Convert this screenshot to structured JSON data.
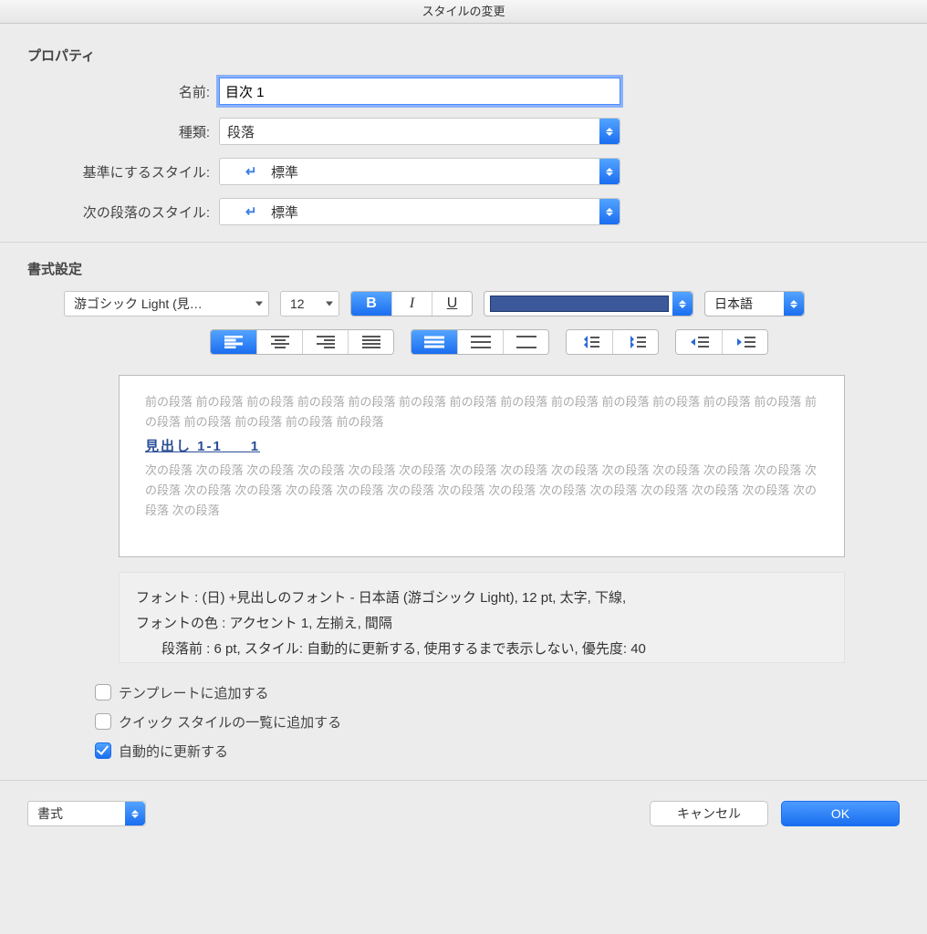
{
  "title": "スタイルの変更",
  "properties": {
    "section": "プロパティ",
    "name_label": "名前:",
    "name_value": "目次 1",
    "type_label": "種類:",
    "type_value": "段落",
    "based_on_label": "基準にするスタイル:",
    "based_on_value": "標準",
    "next_para_label": "次の段落のスタイル:",
    "next_para_value": "標準"
  },
  "formatting": {
    "section": "書式設定",
    "font_name": "游ゴシック Light (見…",
    "font_size": "12",
    "bold": "B",
    "italic": "I",
    "underline": "U",
    "color_hex": "#3b599a",
    "language": "日本語"
  },
  "preview": {
    "prev_para_word": "前の段落",
    "heading": "見出し 1-1",
    "heading_page": "1",
    "next_para_word": "次の段落"
  },
  "description": {
    "line1": "フォント : (日) +見出しのフォント - 日本語 (游ゴシック Light), 12 pt, 太字, 下線,",
    "line2": "フォントの色 : アクセント 1, 左揃え, 間隔",
    "line3": "段落前 :  6 pt, スタイル: 自動的に更新する, 使用するまで表示しない, 優先度: 40"
  },
  "checks": {
    "add_template": "テンプレートに追加する",
    "add_quick": "クイック スタイルの一覧に追加する",
    "auto_update": "自動的に更新する"
  },
  "footer": {
    "format_menu": "書式",
    "cancel": "キャンセル",
    "ok": "OK"
  }
}
